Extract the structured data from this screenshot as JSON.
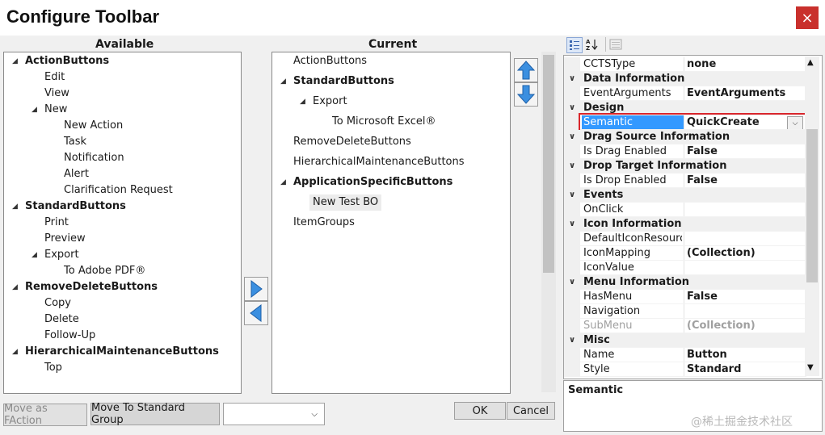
{
  "window": {
    "title": "Configure Toolbar",
    "close_label": "×"
  },
  "available": {
    "header": "Available",
    "items": [
      {
        "label": "ActionButtons",
        "level": 0,
        "bold": true,
        "expander": "◢"
      },
      {
        "label": "Edit",
        "level": 2
      },
      {
        "label": "View",
        "level": 2
      },
      {
        "label": "New",
        "level": 1,
        "expander": "◢"
      },
      {
        "label": "New Action",
        "level": 3
      },
      {
        "label": "Task",
        "level": 3
      },
      {
        "label": "Notification",
        "level": 3
      },
      {
        "label": "Alert",
        "level": 3
      },
      {
        "label": "Clarification Request",
        "level": 3
      },
      {
        "label": "StandardButtons",
        "level": 0,
        "bold": true,
        "expander": "◢"
      },
      {
        "label": "Print",
        "level": 2
      },
      {
        "label": "Preview",
        "level": 2
      },
      {
        "label": "Export",
        "level": 1,
        "expander": "◢"
      },
      {
        "label": "To Adobe PDF®",
        "level": 3
      },
      {
        "label": "RemoveDeleteButtons",
        "level": 0,
        "bold": true,
        "expander": "◢"
      },
      {
        "label": "Copy",
        "level": 2
      },
      {
        "label": "Delete",
        "level": 2
      },
      {
        "label": "Follow-Up",
        "level": 2
      },
      {
        "label": "HierarchicalMaintenanceButtons",
        "level": 0,
        "bold": true,
        "expander": "◢"
      },
      {
        "label": "Top",
        "level": 2
      }
    ]
  },
  "current": {
    "header": "Current",
    "items": [
      {
        "label": "ActionButtons",
        "level": 0
      },
      {
        "label": "StandardButtons",
        "level": 0,
        "bold": true,
        "expander": "◢"
      },
      {
        "label": "Export",
        "level": 1,
        "expander": "◢"
      },
      {
        "label": "To Microsoft Excel®",
        "level": 3
      },
      {
        "label": "RemoveDeleteButtons",
        "level": 0
      },
      {
        "label": "HierarchicalMaintenanceButtons",
        "level": 0
      },
      {
        "label": "ApplicationSpecificButtons",
        "level": 0,
        "bold": true,
        "expander": "◢"
      },
      {
        "label": "New Test BO",
        "level": 2,
        "selected": true
      },
      {
        "label": "ItemGroups",
        "level": 0
      }
    ]
  },
  "buttons": {
    "move_as_faction": "Move as FAction",
    "move_to_standard": "Move To Standard Group",
    "ok": "OK",
    "cancel": "Cancel",
    "group_dropdown": ""
  },
  "property_grid": {
    "rows": [
      {
        "type": "prop",
        "name": "CCTSType",
        "value": "none"
      },
      {
        "type": "cat",
        "name": "Data Information"
      },
      {
        "type": "prop",
        "name": "EventArguments",
        "value": "EventArguments"
      },
      {
        "type": "cat",
        "name": "Design"
      },
      {
        "type": "prop",
        "name": "Semantic",
        "value": "QuickCreate",
        "selected": true
      },
      {
        "type": "cat",
        "name": "Drag Source Information"
      },
      {
        "type": "prop",
        "name": "Is Drag Enabled",
        "value": "False"
      },
      {
        "type": "cat",
        "name": "Drop Target Information"
      },
      {
        "type": "prop",
        "name": "Is Drop Enabled",
        "value": "False"
      },
      {
        "type": "cat",
        "name": "Events"
      },
      {
        "type": "prop",
        "name": "OnClick",
        "value": ""
      },
      {
        "type": "cat",
        "name": "Icon Information"
      },
      {
        "type": "prop",
        "name": "DefaultIconResource",
        "value": ""
      },
      {
        "type": "prop",
        "name": "IconMapping",
        "value": "(Collection)"
      },
      {
        "type": "prop",
        "name": "IconValue",
        "value": ""
      },
      {
        "type": "cat",
        "name": "Menu Information"
      },
      {
        "type": "prop",
        "name": "HasMenu",
        "value": "False"
      },
      {
        "type": "prop",
        "name": "Navigation",
        "value": ""
      },
      {
        "type": "prop",
        "name": "SubMenu",
        "value": "(Collection)",
        "disabled": true
      },
      {
        "type": "cat",
        "name": "Misc"
      },
      {
        "type": "prop",
        "name": "Name",
        "value": "Button"
      },
      {
        "type": "prop",
        "name": "Style",
        "value": "Standard"
      }
    ],
    "description_title": "Semantic",
    "highlight_color": "#d9262c",
    "selection_color": "#3399ff"
  },
  "watermark": "@稀土掘金技术社区"
}
